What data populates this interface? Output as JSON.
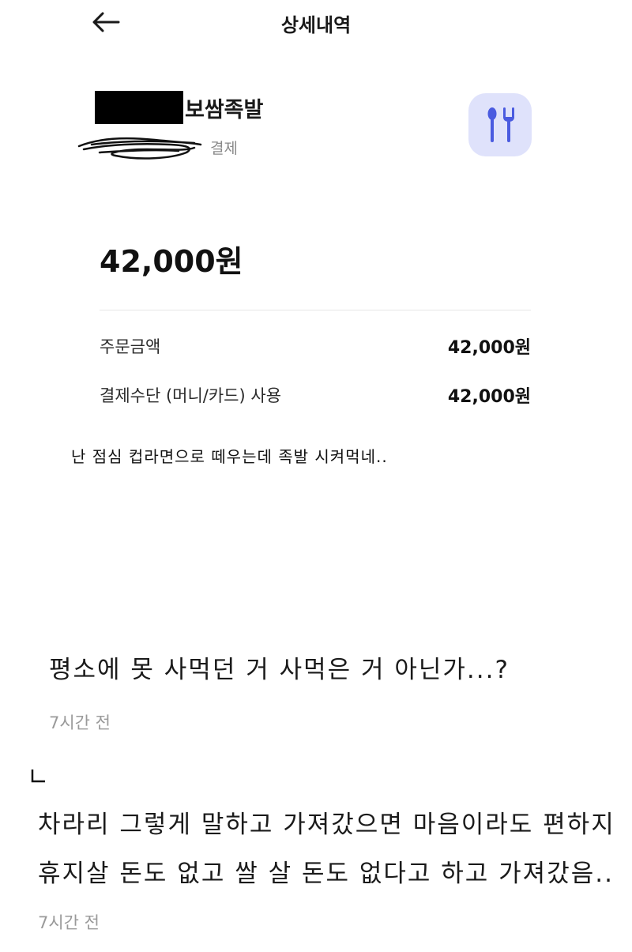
{
  "header": {
    "title": "상세내역",
    "back_icon": "arrow-left-icon"
  },
  "transaction": {
    "merchant_suffix": "보쌈족발",
    "payment_type": "결제",
    "category_icon": "fork-spoon-icon",
    "icon_bg_color": "#dfe2fb",
    "icon_color": "#4a5be0",
    "amount": "42,000원",
    "details": [
      {
        "label": "주문금액",
        "value": "42,000원"
      },
      {
        "label": "결제수단 (머니/카드) 사용",
        "value": "42,000원"
      }
    ]
  },
  "caption": "난 점심 컵라면으로 떼우는데 족발 시켜먹네..",
  "comments": [
    {
      "text": "평소에 못 사먹던 거 사먹은 거 아닌가...?",
      "time": "7시간 전"
    },
    {
      "reply_mark": "ㄴ",
      "lines": [
        "차라리 그렇게 말하고 가져갔으면 마음이라도 편하지",
        "휴지살 돈도 없고 쌀 살 돈도 없다고 하고 가져갔음.."
      ],
      "time": "7시간 전"
    }
  ]
}
